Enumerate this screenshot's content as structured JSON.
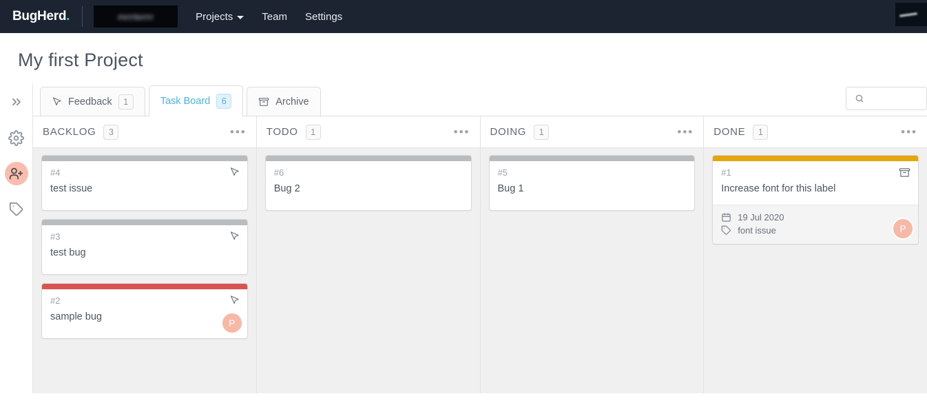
{
  "topnav": {
    "logo_text": "BugHerd",
    "logo_dot": ".",
    "org_name": "mrrrterrrr",
    "items": [
      {
        "label": "Projects",
        "has_caret": true
      },
      {
        "label": "Team",
        "has_caret": false
      },
      {
        "label": "Settings",
        "has_caret": false
      }
    ]
  },
  "page": {
    "title": "My first Project"
  },
  "rail": {
    "items": [
      {
        "name": "expand-panel",
        "icon": "double-chevron-right-icon",
        "active": false
      },
      {
        "name": "settings",
        "icon": "gear-icon",
        "active": false
      },
      {
        "name": "invite-member",
        "icon": "add-user-icon",
        "active": true
      },
      {
        "name": "tags",
        "icon": "tag-icon",
        "active": false
      }
    ]
  },
  "tabs": [
    {
      "label": "Feedback",
      "count": "1",
      "icon": "cursor-arrow-icon",
      "active": false
    },
    {
      "label": "Task Board",
      "count": "6",
      "icon": "",
      "active": true
    },
    {
      "label": "Archive",
      "count": "",
      "icon": "archive-box-icon",
      "active": false
    }
  ],
  "search": {
    "placeholder": "",
    "value": "",
    "icon": "search-icon"
  },
  "columns": [
    {
      "title": "BACKLOG",
      "count": "3",
      "menu": "•••",
      "cards": [
        {
          "id": "#4",
          "title": "test issue",
          "bar_color": "#b9bcbf",
          "icon": "cursor-arrow-icon",
          "avatar": "",
          "date": "",
          "tag": ""
        },
        {
          "id": "#3",
          "title": "test bug",
          "bar_color": "#b9bcbf",
          "icon": "cursor-arrow-icon",
          "avatar": "",
          "date": "",
          "tag": ""
        },
        {
          "id": "#2",
          "title": "sample bug",
          "bar_color": "#d9534f",
          "icon": "cursor-arrow-icon",
          "avatar": "P",
          "date": "",
          "tag": ""
        }
      ]
    },
    {
      "title": "TODO",
      "count": "1",
      "menu": "•••",
      "cards": [
        {
          "id": "#6",
          "title": "Bug 2",
          "bar_color": "#b9bcbf",
          "icon": "",
          "avatar": "",
          "date": "",
          "tag": ""
        }
      ]
    },
    {
      "title": "DOING",
      "count": "1",
      "menu": "•••",
      "cards": [
        {
          "id": "#5",
          "title": "Bug 1",
          "bar_color": "#b9bcbf",
          "icon": "",
          "avatar": "",
          "date": "",
          "tag": ""
        }
      ]
    },
    {
      "title": "DONE",
      "count": "1",
      "menu": "•••",
      "cards": [
        {
          "id": "#1",
          "title": "Increase font for this label",
          "bar_color": "#e3a70d",
          "icon": "archive-box-icon",
          "avatar": "P",
          "date": "19 Jul 2020",
          "tag": "font issue"
        }
      ]
    }
  ],
  "colors": {
    "nav_bg": "#1b2430",
    "accent_blue": "#49b6e8",
    "avatar_bg": "#f7b8a6",
    "rail_active_bg": "#f9bdae",
    "board_bg": "#f0f0f0"
  }
}
